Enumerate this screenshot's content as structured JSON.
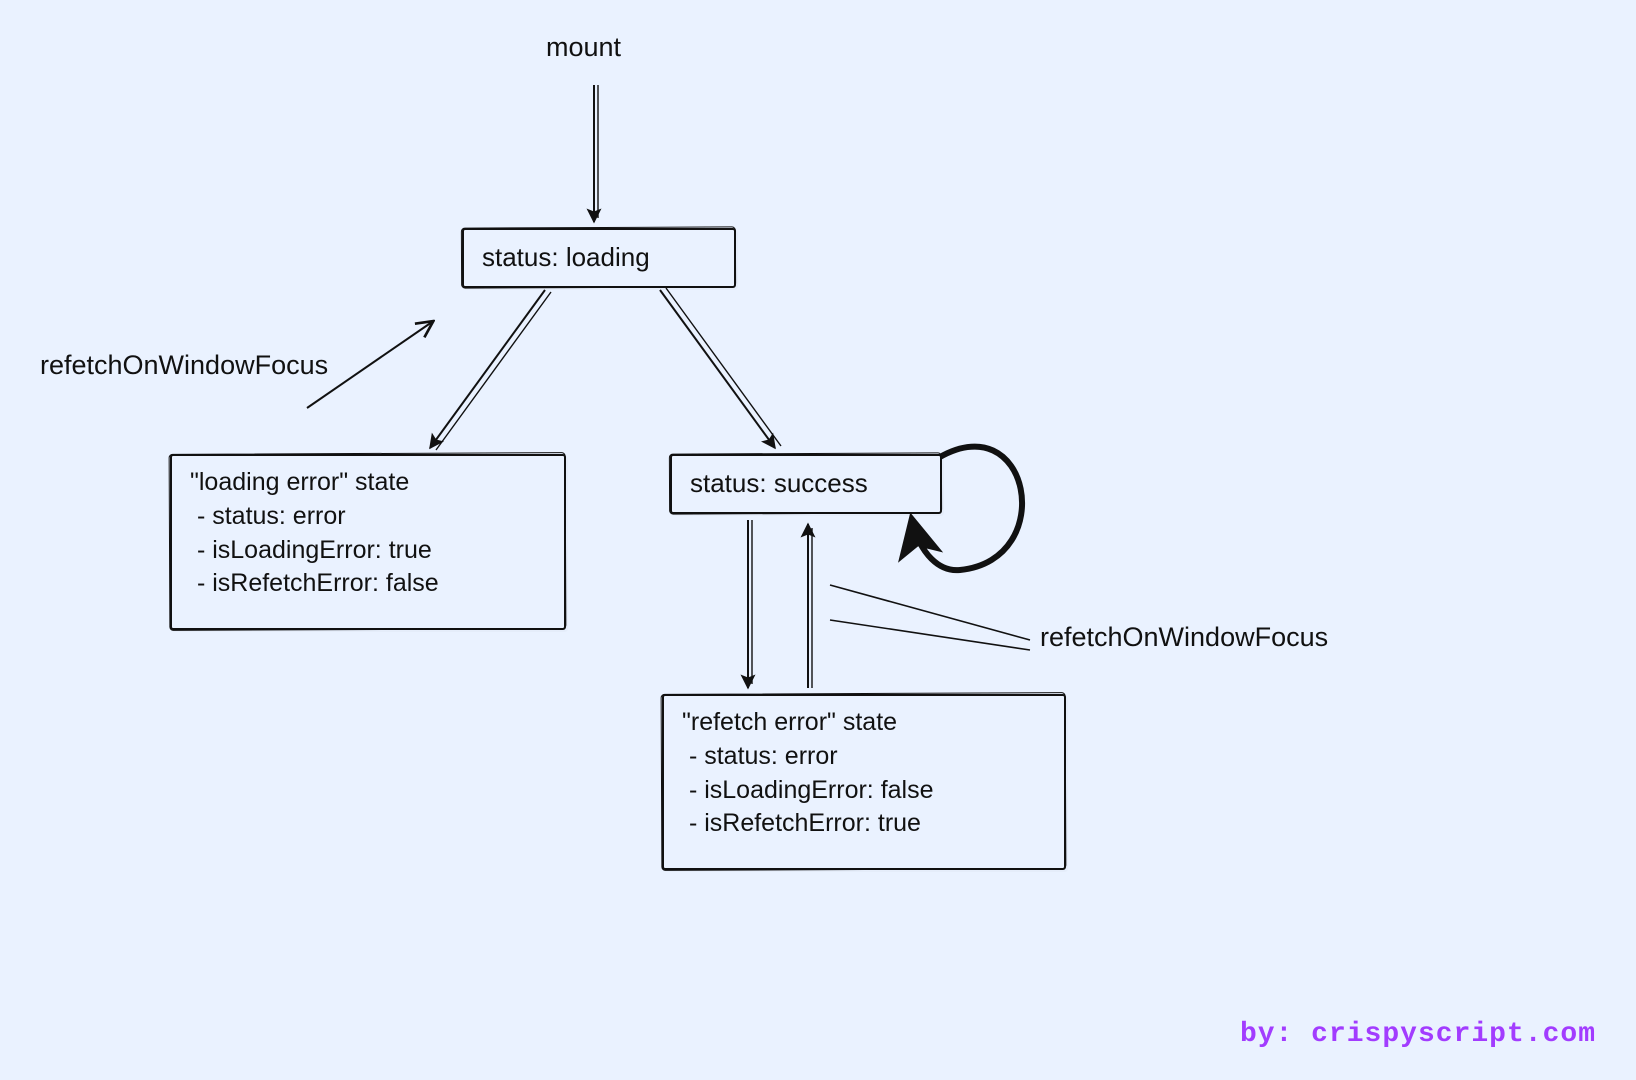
{
  "labels": {
    "mount": "mount",
    "refetch_left": "refetchOnWindowFocus",
    "refetch_right": "refetchOnWindowFocus"
  },
  "nodes": {
    "loading": "status: loading",
    "success": "status: success",
    "loading_error": "\"loading error\" state\n - status: error\n - isLoadingError: true\n - isRefetchError: false",
    "refetch_error": "\"refetch error\" state\n - status: error\n - isLoadingError: false\n - isRefetchError: true"
  },
  "credit": "by: crispyscript.com"
}
